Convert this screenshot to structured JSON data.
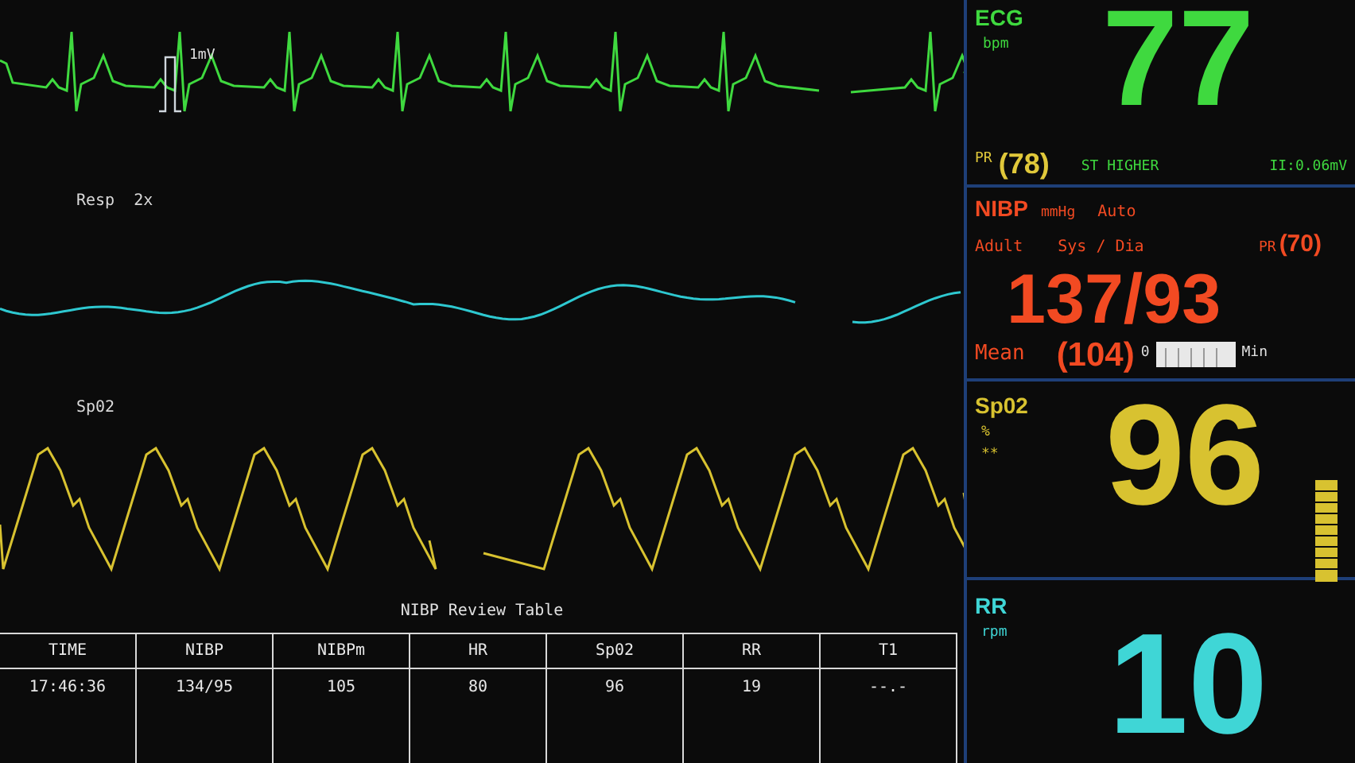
{
  "waveforms": {
    "ecg": {
      "scale": "1mV"
    },
    "resp": {
      "label": "Resp",
      "gain": "2x"
    },
    "spo2": {
      "label": "Sp02"
    }
  },
  "review_table": {
    "title": "NIBP Review Table",
    "columns": [
      "TIME",
      "NIBP",
      "NIBPm",
      "HR",
      "Sp02",
      "RR",
      "T1"
    ],
    "rows": [
      [
        "17:46:36",
        "134/95",
        "105",
        "80",
        "96",
        "19",
        "--.-"
      ]
    ]
  },
  "ecg": {
    "label": "ECG",
    "unit": "bpm",
    "value": "77",
    "pr_label": "PR",
    "pr_value": "(78)",
    "st_status": "ST HIGHER",
    "st_value": "II:0.06mV"
  },
  "nibp": {
    "label": "NIBP",
    "unit": "mmHg",
    "mode": "Auto",
    "patient": "Adult",
    "sub": "Sys / Dia",
    "pr_label": "PR",
    "pr_value": "(70)",
    "value": "137/93",
    "mean_label": "Mean",
    "mean_value": "(104)",
    "gauge_min": "0",
    "gauge_max": "Min"
  },
  "spo2": {
    "label": "Sp02",
    "unit": "%",
    "quality": "**",
    "value": "96"
  },
  "rr": {
    "label": "RR",
    "unit": "rpm",
    "value": "10"
  }
}
